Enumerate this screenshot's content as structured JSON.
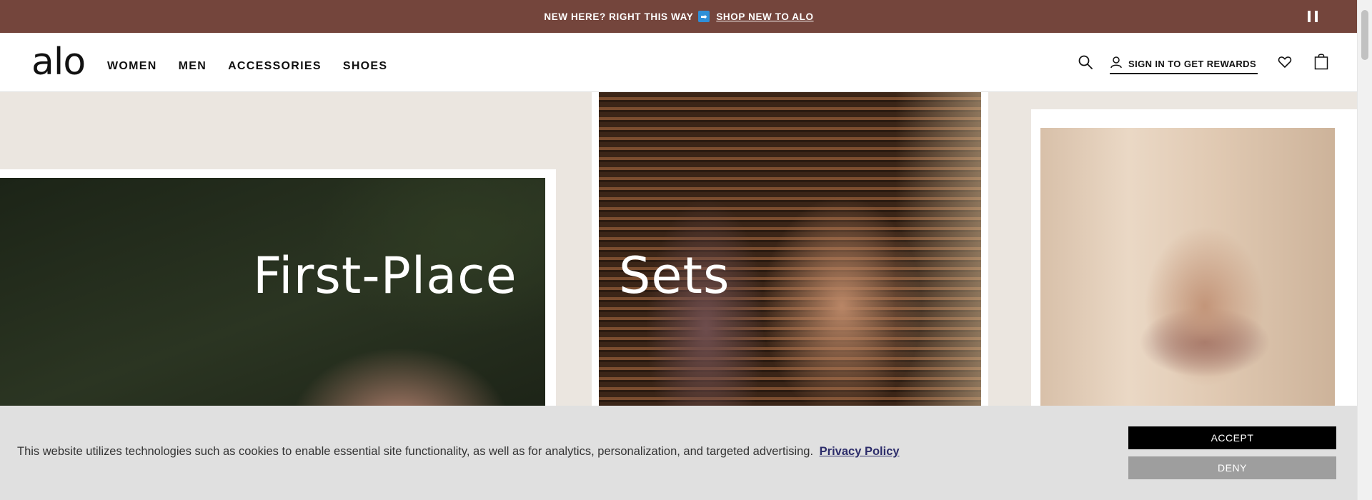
{
  "announcement": {
    "text": "NEW HERE? RIGHT THIS WAY",
    "arrow_icon": "➡",
    "link": "SHOP NEW TO ALO",
    "pause_icon": "pause-icon"
  },
  "header": {
    "logo": "alo",
    "nav": [
      "WOMEN",
      "MEN",
      "ACCESSORIES",
      "SHOES"
    ],
    "signin": "SIGN IN TO GET REWARDS",
    "icons": [
      "search-icon",
      "user-icon",
      "heart-icon",
      "bag-icon"
    ]
  },
  "hero": {
    "panels": [
      {
        "text": "First-Place"
      },
      {
        "text": "Sets"
      },
      {
        "text": ""
      }
    ]
  },
  "cookie": {
    "message": "This website utilizes technologies such as cookies to enable essential site functionality, as well as for analytics, personalization, and targeted advertising.",
    "policy_link": "Privacy Policy",
    "accept": "ACCEPT",
    "deny": "DENY"
  },
  "colors": {
    "announcement_bg": "#74453c",
    "accept_bg": "#000000",
    "deny_bg": "#9e9e9e",
    "cookie_bg": "#e0e0e0"
  }
}
